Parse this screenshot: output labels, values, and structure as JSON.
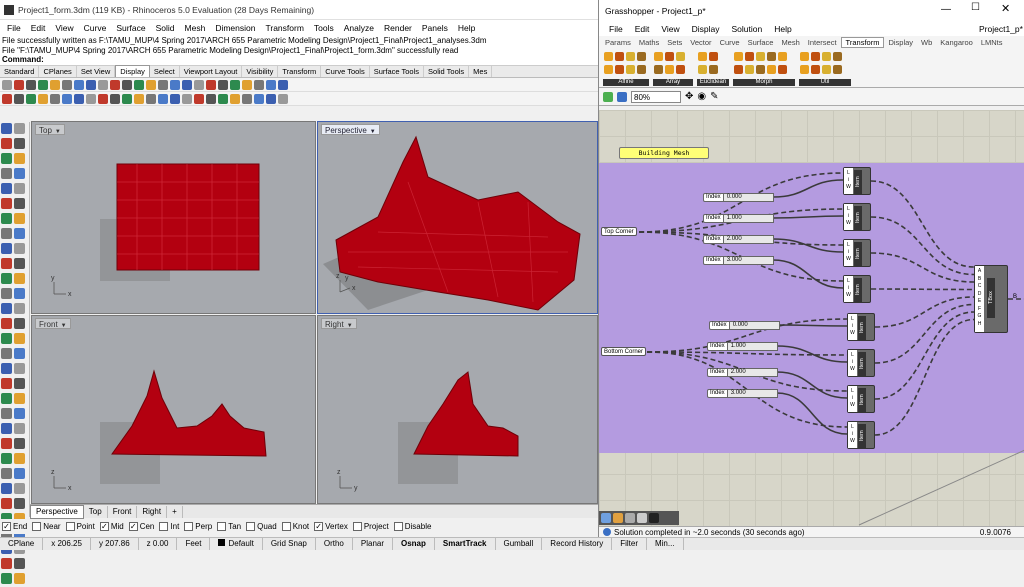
{
  "rhino": {
    "title": "Project1_form.3dm (119 KB) - Rhinoceros 5.0 Evaluation (28 Days Remaining)",
    "menu": [
      "File",
      "Edit",
      "View",
      "Curve",
      "Surface",
      "Solid",
      "Mesh",
      "Dimension",
      "Transform",
      "Tools",
      "Analyze",
      "Render",
      "Panels",
      "Help"
    ],
    "cmd_history": [
      "File successfully written as F:\\TAMU_MUP\\4 Spring 2017\\ARCH 655 Parametric Modeling Design\\Project1_Final\\Project1_analyses.3dm",
      "File \"F:\\TAMU_MUP\\4 Spring 2017\\ARCH 655 Parametric Modeling Design\\Project1_Final\\Project1_form.3dm\" successfully read"
    ],
    "command_label": "Command:",
    "toolbar_tabs": [
      "Standard",
      "CPlanes",
      "Set View",
      "Display",
      "Select",
      "Viewport Layout",
      "Visibility",
      "Transform",
      "Curve Tools",
      "Surface Tools",
      "Solid Tools",
      "Mes"
    ],
    "active_toolbar_tab": "Display",
    "viewports": {
      "top": "Top",
      "perspective": "Perspective",
      "front": "Front",
      "right": "Right"
    },
    "axis": {
      "x": "x",
      "y": "y",
      "z": "z"
    },
    "viewport_tabs": [
      "Perspective",
      "Top",
      "Front",
      "Right"
    ],
    "add_tab": "+",
    "osnaps": [
      {
        "label": "End",
        "checked": true
      },
      {
        "label": "Near",
        "checked": false
      },
      {
        "label": "Point",
        "checked": false
      },
      {
        "label": "Mid",
        "checked": true
      },
      {
        "label": "Cen",
        "checked": true
      },
      {
        "label": "Int",
        "checked": false
      },
      {
        "label": "Perp",
        "checked": false
      },
      {
        "label": "Tan",
        "checked": false
      },
      {
        "label": "Quad",
        "checked": false
      },
      {
        "label": "Knot",
        "checked": false
      },
      {
        "label": "Vertex",
        "checked": true
      },
      {
        "label": "Project",
        "checked": false
      },
      {
        "label": "Disable",
        "checked": false
      }
    ],
    "status": {
      "cplane": "CPlane",
      "x": "x 206.25",
      "y": "y 207.86",
      "z": "z 0.00",
      "units": "Feet",
      "layer": "Default",
      "modes": [
        "Grid Snap",
        "Ortho",
        "Planar",
        "Osnap",
        "SmartTrack",
        "Gumball",
        "Record History",
        "Filter",
        "Min..."
      ],
      "active_modes": [
        "Osnap",
        "SmartTrack"
      ]
    }
  },
  "grasshopper": {
    "title": "Grasshopper - Project1_p*",
    "doc_name": "Project1_p*",
    "menu": [
      "File",
      "Edit",
      "View",
      "Display",
      "Solution",
      "Help"
    ],
    "tabs": [
      "Params",
      "Maths",
      "Sets",
      "Vector",
      "Curve",
      "Surface",
      "Mesh",
      "Intersect",
      "Transform",
      "Display",
      "Wb",
      "Kangaroo",
      "LMNts"
    ],
    "active_tab": "Transform",
    "ribbon_groups": [
      "Affine",
      "Array",
      "Euclidean",
      "Morph",
      "Util"
    ],
    "zoom": "80%",
    "note": "Building Mesh",
    "params": {
      "top": "Top Corner",
      "bottom": "Bottom Corner"
    },
    "slider_label": "Index",
    "sliders_top": [
      "0.000",
      "1.000",
      "2.000",
      "3.000"
    ],
    "sliders_bottom": [
      "0.000",
      "1.000",
      "2.000",
      "3.000"
    ],
    "item_label": "Item",
    "item_ports": [
      "L",
      "i",
      "W"
    ],
    "tbox_label": "TBox",
    "tbox_inputs": [
      "A",
      "B",
      "C",
      "D",
      "E",
      "F",
      "G",
      "H"
    ],
    "tbox_output": "B",
    "status": "Solution completed in ~2.0 seconds (30 seconds ago)",
    "version": "0.9.0076"
  },
  "colors": {
    "mesh": "#c0000e",
    "group": "#b49be0",
    "canvas": "#d7d6c9",
    "viewport": "#a6a9ae"
  }
}
